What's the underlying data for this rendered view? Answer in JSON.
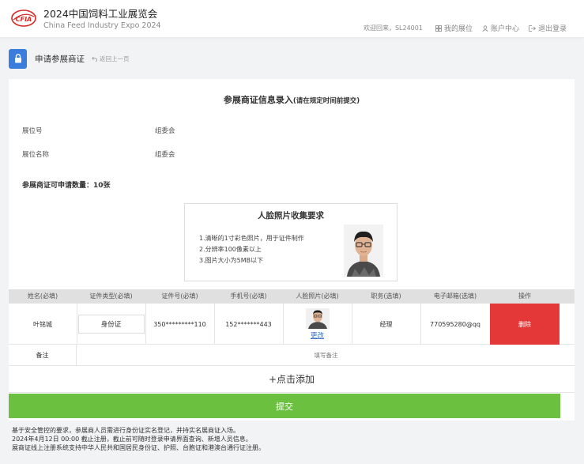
{
  "header": {
    "title": "2024中国饲料工业展览会",
    "subtitle": "China Feed Industry Expo 2024",
    "logo_text": "CFIA",
    "welcome": "欢迎回来，SL24001",
    "nav": {
      "my_booth": "我的展位",
      "account": "账户中心",
      "logout": "退出登录"
    }
  },
  "page": {
    "title": "申请参展商证",
    "back": "返回上一页"
  },
  "form": {
    "heading": "参展商证信息录入",
    "heading_note": "(请在规定时间前提交)",
    "booth_no_label": "展位号",
    "booth_no_value": "组委会",
    "booth_name_label": "展位名称",
    "booth_name_value": "组委会",
    "quota": "参展商证可申请数量：10张"
  },
  "requirements": {
    "title": "人脸照片收集要求",
    "lines": [
      "1.清晰的1寸彩色照片，用于证件制作",
      "2.分辨率100像素以上",
      "3.图片大小为5MB以下"
    ]
  },
  "table": {
    "headers": [
      "姓名(必填)",
      "证件类型(必填)",
      "证件号(必填)",
      "手机号(必填)",
      "人脸照片(必填)",
      "职务(选填)",
      "电子邮箱(选填)",
      "操作"
    ],
    "row": {
      "name": "叶铭城",
      "id_type": "身份证",
      "id_number": "350*********110",
      "phone": "152*******443",
      "photo_action": "更改",
      "position": "经理",
      "email": "770595280@qq",
      "delete": "删除"
    },
    "remark_label": "备注",
    "remark_placeholder": "填写备注"
  },
  "add_label": "+点击添加",
  "submit_label": "提交",
  "footer": [
    "基于安全管控的要求，参展商人员需进行身份证实名登记，并持实名展商证入场。",
    "2024年4月12日 00:00 截止注册，截止前可随时登录申请界面查询、新增人员信息。",
    "展商证线上注册系统支持中华人民共和国居民身份证、护照、台胞证和港澳台通行证注册。"
  ],
  "colors": {
    "accent_blue": "#3b7ddd",
    "delete_red": "#e43838",
    "submit_green": "#6cc040",
    "logo_red": "#d42a26"
  }
}
